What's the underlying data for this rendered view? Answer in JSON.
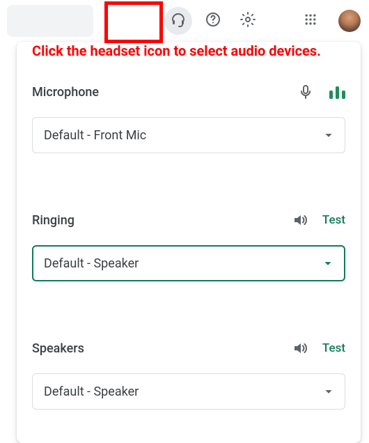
{
  "annotation": "Click the headset icon to select audio devices.",
  "sections": {
    "mic": {
      "title": "Microphone",
      "selected": "Default - Front Mic"
    },
    "ringing": {
      "title": "Ringing",
      "selected": "Default - Speaker",
      "test": "Test"
    },
    "speakers": {
      "title": "Speakers",
      "selected": "Default - Speaker",
      "test": "Test"
    }
  }
}
